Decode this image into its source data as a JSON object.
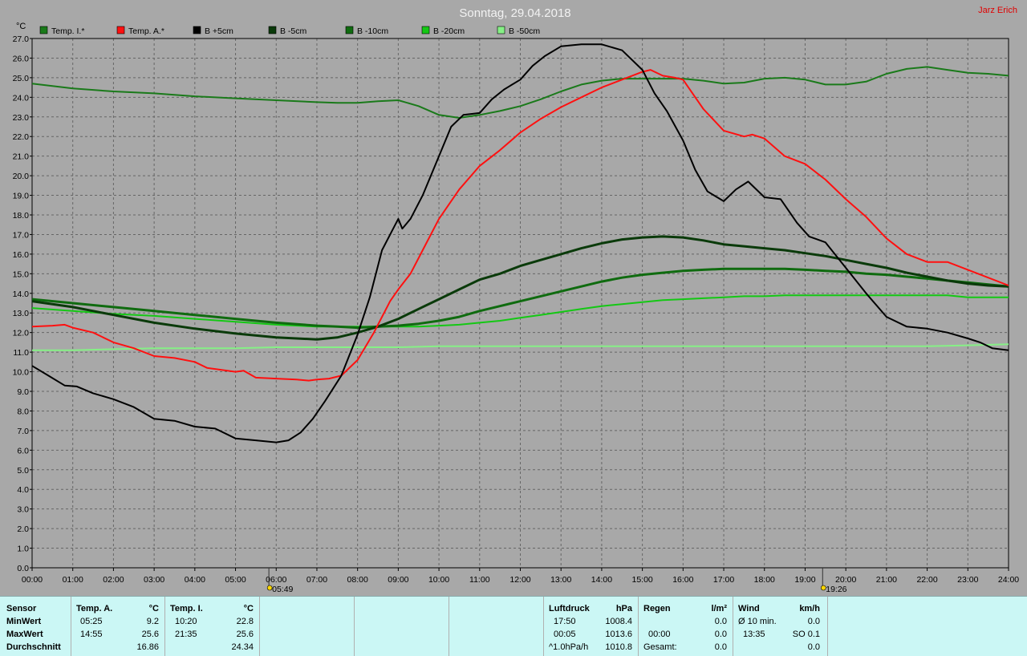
{
  "header": {
    "title": "Sonntag, 29.04.2018",
    "author": "Jarz Erich"
  },
  "chart_data": {
    "type": "line",
    "title": "Sonntag, 29.04.2018",
    "ylabel": "°C",
    "ylim": [
      0,
      27
    ],
    "xlim": [
      0,
      24
    ],
    "grid": true,
    "legend_position": "top",
    "y_ticks": [
      "0.0",
      "1.0",
      "2.0",
      "3.0",
      "4.0",
      "5.0",
      "6.0",
      "7.0",
      "8.0",
      "9.0",
      "10.0",
      "11.0",
      "12.0",
      "13.0",
      "14.0",
      "15.0",
      "16.0",
      "17.0",
      "18.0",
      "19.0",
      "20.0",
      "21.0",
      "22.0",
      "23.0",
      "24.0",
      "25.0",
      "26.0",
      "27.0"
    ],
    "x_ticks": [
      "00:00",
      "01:00",
      "02:00",
      "03:00",
      "04:00",
      "05:00",
      "06:00",
      "07:00",
      "08:00",
      "09:00",
      "10:00",
      "11:00",
      "12:00",
      "13:00",
      "14:00",
      "15:00",
      "16:00",
      "17:00",
      "18:00",
      "19:00",
      "20:00",
      "21:00",
      "22:00",
      "23:00",
      "24:00"
    ],
    "markers": [
      {
        "time": 5.82,
        "label": "05:49",
        "kind": "sunrise"
      },
      {
        "time": 19.43,
        "label": "19:26",
        "kind": "sunset"
      }
    ],
    "series": [
      {
        "name": "Temp. I.*",
        "color": "#1a7a1a",
        "width": 2,
        "x": [
          0,
          1,
          2,
          3,
          4,
          5,
          6,
          7,
          7.5,
          8,
          8.5,
          9,
          9.5,
          10,
          10.5,
          11,
          11.5,
          12,
          12.5,
          13,
          13.5,
          14,
          14.5,
          15,
          15.5,
          16,
          16.5,
          17,
          17.5,
          18,
          18.5,
          19,
          19.5,
          20,
          20.5,
          21,
          21.5,
          22,
          22.5,
          23,
          23.5,
          24
        ],
        "y": [
          24.7,
          24.45,
          24.3,
          24.2,
          24.05,
          23.95,
          23.85,
          23.75,
          23.72,
          23.72,
          23.8,
          23.85,
          23.55,
          23.1,
          22.95,
          23.1,
          23.3,
          23.55,
          23.9,
          24.3,
          24.65,
          24.85,
          24.95,
          24.95,
          24.95,
          24.95,
          24.85,
          24.7,
          24.75,
          24.95,
          25.0,
          24.9,
          24.65,
          24.65,
          24.8,
          25.2,
          25.45,
          25.55,
          25.4,
          25.25,
          25.2,
          25.1
        ]
      },
      {
        "name": "Temp. A.*",
        "color": "#ff1010",
        "width": 2,
        "x": [
          0,
          0.5,
          0.8,
          1,
          1.5,
          2,
          2.5,
          3,
          3.5,
          4,
          4.3,
          5,
          5.2,
          5.5,
          6,
          6.5,
          6.8,
          7,
          7.3,
          7.6,
          8,
          8.4,
          8.8,
          9,
          9.3,
          9.6,
          10,
          10.5,
          11,
          11.5,
          12,
          12.5,
          13,
          13.5,
          14,
          14.5,
          15,
          15.2,
          15.5,
          15.8,
          16,
          16.5,
          17,
          17.5,
          17.7,
          18,
          18.5,
          19,
          19.5,
          20,
          20.5,
          21,
          21.5,
          22,
          22.5,
          23,
          23.5,
          24
        ],
        "y": [
          12.3,
          12.35,
          12.4,
          12.25,
          12.0,
          11.5,
          11.2,
          10.8,
          10.7,
          10.5,
          10.2,
          10.0,
          10.05,
          9.7,
          9.65,
          9.6,
          9.55,
          9.6,
          9.65,
          9.8,
          10.6,
          12.0,
          13.6,
          14.2,
          15.0,
          16.2,
          17.8,
          19.3,
          20.5,
          21.3,
          22.2,
          22.9,
          23.5,
          24.0,
          24.5,
          24.9,
          25.3,
          25.4,
          25.1,
          25.0,
          24.9,
          23.4,
          22.3,
          22.0,
          22.1,
          21.9,
          21.0,
          20.6,
          19.8,
          18.8,
          17.9,
          16.8,
          16.0,
          15.6,
          15.6,
          15.2,
          14.8,
          14.4
        ]
      },
      {
        "name": "B +5cm",
        "color": "#000000",
        "width": 2,
        "x": [
          0,
          0.4,
          0.8,
          1.1,
          1.5,
          2.0,
          2.5,
          3.0,
          3.5,
          4.0,
          4.5,
          5.0,
          5.5,
          6.0,
          6.3,
          6.6,
          6.9,
          7.2,
          7.6,
          8.0,
          8.3,
          8.6,
          8.9,
          9.0,
          9.1,
          9.3,
          9.6,
          10.0,
          10.3,
          10.6,
          11.0,
          11.3,
          11.6,
          12.0,
          12.3,
          12.6,
          13.0,
          13.5,
          14.0,
          14.5,
          15.0,
          15.3,
          15.6,
          16.0,
          16.3,
          16.6,
          17.0,
          17.3,
          17.6,
          18.0,
          18.4,
          18.8,
          19.1,
          19.5,
          20.0,
          20.5,
          21.0,
          21.5,
          22.0,
          22.5,
          23.0,
          23.3,
          23.6,
          24.0
        ],
        "y": [
          10.3,
          9.8,
          9.3,
          9.25,
          8.9,
          8.6,
          8.2,
          7.6,
          7.5,
          7.2,
          7.1,
          6.6,
          6.5,
          6.4,
          6.5,
          6.9,
          7.6,
          8.5,
          9.8,
          11.9,
          13.8,
          16.2,
          17.4,
          17.8,
          17.3,
          17.8,
          19.0,
          21.0,
          22.5,
          23.1,
          23.2,
          23.9,
          24.4,
          24.9,
          25.6,
          26.1,
          26.6,
          26.7,
          26.7,
          26.4,
          25.4,
          24.2,
          23.3,
          21.8,
          20.3,
          19.2,
          18.7,
          19.3,
          19.7,
          18.9,
          18.8,
          17.6,
          16.9,
          16.6,
          15.3,
          14.0,
          12.8,
          12.3,
          12.2,
          12.0,
          11.7,
          11.5,
          11.2,
          11.1
        ]
      },
      {
        "name": "B -5cm",
        "color": "#0a3a0a",
        "width": 3,
        "x": [
          0,
          1,
          2,
          3,
          4,
          5,
          6,
          7,
          7.5,
          8,
          8.5,
          9,
          9.5,
          10,
          10.5,
          11,
          11.5,
          12,
          12.5,
          13,
          13.5,
          14,
          14.5,
          15,
          15.5,
          16,
          16.5,
          17,
          17.5,
          18,
          18.5,
          19,
          19.5,
          20,
          20.5,
          21,
          21.5,
          22,
          22.5,
          23,
          23.5,
          24
        ],
        "y": [
          13.6,
          13.3,
          12.9,
          12.5,
          12.2,
          11.95,
          11.75,
          11.65,
          11.75,
          12.0,
          12.3,
          12.7,
          13.2,
          13.7,
          14.2,
          14.7,
          15.0,
          15.4,
          15.7,
          16.0,
          16.3,
          16.55,
          16.75,
          16.85,
          16.9,
          16.85,
          16.7,
          16.5,
          16.4,
          16.3,
          16.2,
          16.05,
          15.9,
          15.7,
          15.5,
          15.3,
          15.05,
          14.85,
          14.65,
          14.5,
          14.4,
          14.35
        ]
      },
      {
        "name": "B -10cm",
        "color": "#0f6b0f",
        "width": 3,
        "x": [
          0,
          1,
          2,
          3,
          4,
          5,
          6,
          7,
          7.5,
          8,
          8.5,
          9,
          9.5,
          10,
          10.5,
          11,
          11.5,
          12,
          12.5,
          13,
          13.5,
          14,
          14.5,
          15,
          15.5,
          16,
          16.5,
          17,
          17.5,
          18,
          18.5,
          19,
          19.5,
          20,
          20.5,
          21,
          21.5,
          22,
          22.5,
          23,
          23.5,
          24
        ],
        "y": [
          13.7,
          13.5,
          13.3,
          13.1,
          12.9,
          12.7,
          12.5,
          12.35,
          12.3,
          12.25,
          12.3,
          12.35,
          12.45,
          12.6,
          12.8,
          13.1,
          13.35,
          13.6,
          13.85,
          14.1,
          14.35,
          14.6,
          14.8,
          14.95,
          15.05,
          15.15,
          15.2,
          15.25,
          15.25,
          15.25,
          15.25,
          15.2,
          15.15,
          15.1,
          15.0,
          14.95,
          14.85,
          14.75,
          14.65,
          14.55,
          14.45,
          14.35
        ]
      },
      {
        "name": "B -20cm",
        "color": "#14c814",
        "width": 2,
        "x": [
          0,
          1,
          2,
          3,
          4,
          5,
          6,
          7,
          7.5,
          8,
          8.5,
          9,
          9.5,
          10,
          10.5,
          11,
          11.5,
          12,
          12.5,
          13,
          13.5,
          14,
          14.5,
          15,
          15.5,
          16,
          16.5,
          17,
          17.5,
          18,
          18.5,
          19,
          19.5,
          20,
          20.5,
          21,
          21.5,
          22,
          22.5,
          23,
          23.5,
          24
        ],
        "y": [
          13.25,
          13.1,
          12.95,
          12.85,
          12.7,
          12.55,
          12.4,
          12.3,
          12.3,
          12.3,
          12.3,
          12.3,
          12.3,
          12.35,
          12.4,
          12.5,
          12.6,
          12.75,
          12.9,
          13.05,
          13.2,
          13.35,
          13.45,
          13.55,
          13.65,
          13.7,
          13.75,
          13.8,
          13.85,
          13.85,
          13.9,
          13.9,
          13.9,
          13.9,
          13.9,
          13.9,
          13.9,
          13.9,
          13.9,
          13.8,
          13.8,
          13.8
        ]
      },
      {
        "name": "B -50cm",
        "color": "#86f086",
        "width": 2,
        "x": [
          0,
          1,
          2,
          3,
          4,
          5,
          6,
          7,
          8,
          9,
          10,
          11,
          12,
          13,
          14,
          15,
          16,
          17,
          18,
          19,
          20,
          21,
          22,
          23,
          24
        ],
        "y": [
          11.1,
          11.1,
          11.15,
          11.2,
          11.2,
          11.2,
          11.25,
          11.25,
          11.25,
          11.25,
          11.3,
          11.3,
          11.3,
          11.3,
          11.3,
          11.3,
          11.3,
          11.3,
          11.3,
          11.3,
          11.3,
          11.3,
          11.3,
          11.35,
          11.4
        ]
      }
    ]
  },
  "footer": {
    "sensor": {
      "header": "Sensor",
      "min": "MinWert",
      "max": "MaxWert",
      "avg": "Durchschnitt"
    },
    "temp_a": {
      "header": "Temp. A.",
      "unit": "°C",
      "min_time": "05:25",
      "min_value": "9.2",
      "max_time": "14:55",
      "max_value": "25.6",
      "avg_value": "16.86"
    },
    "temp_i": {
      "header": "Temp. I.",
      "unit": "°C",
      "min_time": "10:20",
      "min_value": "22.8",
      "max_time": "21:35",
      "max_value": "25.6",
      "avg_value": "24.34"
    },
    "pressure": {
      "header": "Luftdruck",
      "unit": "hPa",
      "min_time": "17:50",
      "min_value": "1008.4",
      "max_time": "00:05",
      "max_value": "1013.6",
      "trend_label": "^1.0hPa/h",
      "trend_value": "1010.8"
    },
    "rain": {
      "header": "Regen",
      "unit": "l/m²",
      "val1": "0.0",
      "time2": "00:00",
      "val2": "0.0",
      "total_label": "Gesamt:",
      "total_value": "0.0"
    },
    "wind": {
      "header": "Wind",
      "unit": "km/h",
      "avg_label": "Ø 10 min.",
      "avg_value": "0.0",
      "max_time": "13:35",
      "max_value": "SO 0.1",
      "val3": "0.0"
    }
  }
}
